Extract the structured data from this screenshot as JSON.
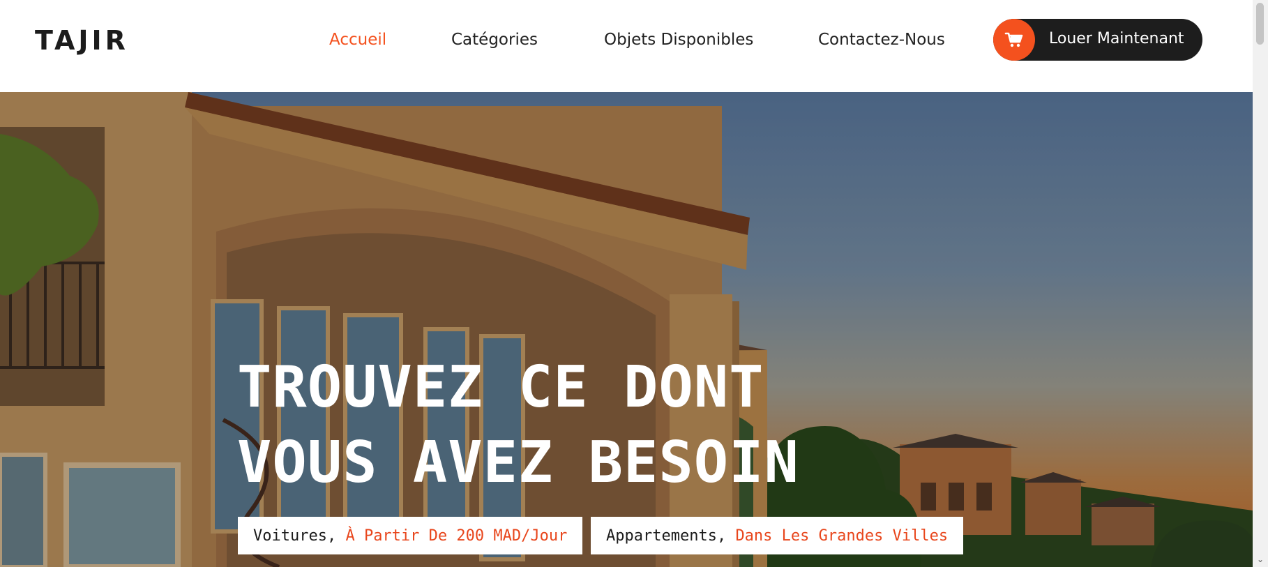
{
  "brand": {
    "logo_text": "TAJIR"
  },
  "nav": {
    "items": [
      {
        "label": "Accueil",
        "active": true
      },
      {
        "label": "Catégories",
        "active": false
      },
      {
        "label": "Objets Disponibles",
        "active": false
      },
      {
        "label": "Contactez-Nous",
        "active": false
      }
    ],
    "cta": {
      "label": "Louer Maintenant",
      "icon": "cart-icon"
    }
  },
  "hero": {
    "headline_line1": "TROUVEZ CE DONT",
    "headline_line2": "VOUS AVEZ BESOIN",
    "tags": [
      {
        "prefix": "Voitures, ",
        "highlight": "À Partir De 200 MAD/Jour"
      },
      {
        "prefix": "Appartements, ",
        "highlight": "Dans Les Grandes Villes"
      }
    ]
  },
  "colors": {
    "accent": "#f4511e",
    "dark": "#1d1d1d",
    "text": "#222222"
  }
}
